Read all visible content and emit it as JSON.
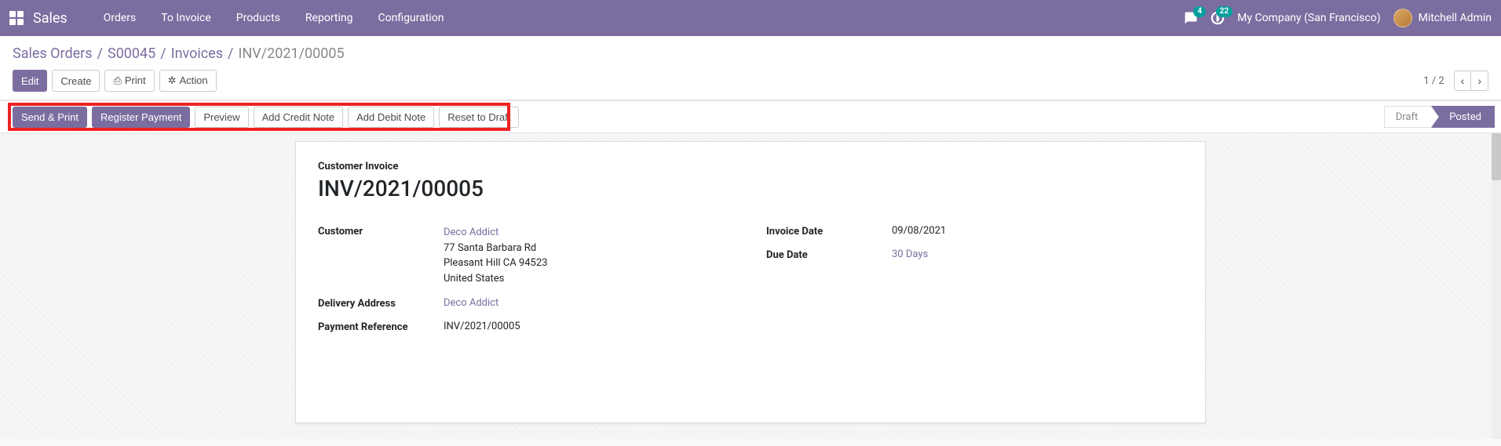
{
  "topbar": {
    "brand": "Sales",
    "nav": [
      "Orders",
      "To Invoice",
      "Products",
      "Reporting",
      "Configuration"
    ],
    "messages_badge": "4",
    "activities_badge": "22",
    "company": "My Company (San Francisco)",
    "user": "Mitchell Admin"
  },
  "breadcrumb": {
    "items": [
      "Sales Orders",
      "S00045",
      "Invoices"
    ],
    "current": "INV/2021/00005"
  },
  "controls": {
    "edit": "Edit",
    "create": "Create",
    "print": "Print",
    "action": "Action",
    "pager": "1 / 2"
  },
  "statusbar": {
    "buttons": [
      "Send & Print",
      "Register Payment",
      "Preview",
      "Add Credit Note",
      "Add Debit Note",
      "Reset to Draft"
    ],
    "states": [
      "Draft",
      "Posted"
    ],
    "active_state": "Posted"
  },
  "sheet": {
    "doc_type": "Customer Invoice",
    "title": "INV/2021/00005",
    "left": {
      "customer_label": "Customer",
      "customer_name": "Deco Addict",
      "customer_addr1": "77 Santa Barbara Rd",
      "customer_addr2": "Pleasant Hill CA 94523",
      "customer_addr3": "United States",
      "delivery_label": "Delivery Address",
      "delivery_value": "Deco Addict",
      "payref_label": "Payment Reference",
      "payref_value": "INV/2021/00005"
    },
    "right": {
      "invdate_label": "Invoice Date",
      "invdate_value": "09/08/2021",
      "duedate_label": "Due Date",
      "duedate_value": "30 Days"
    }
  }
}
